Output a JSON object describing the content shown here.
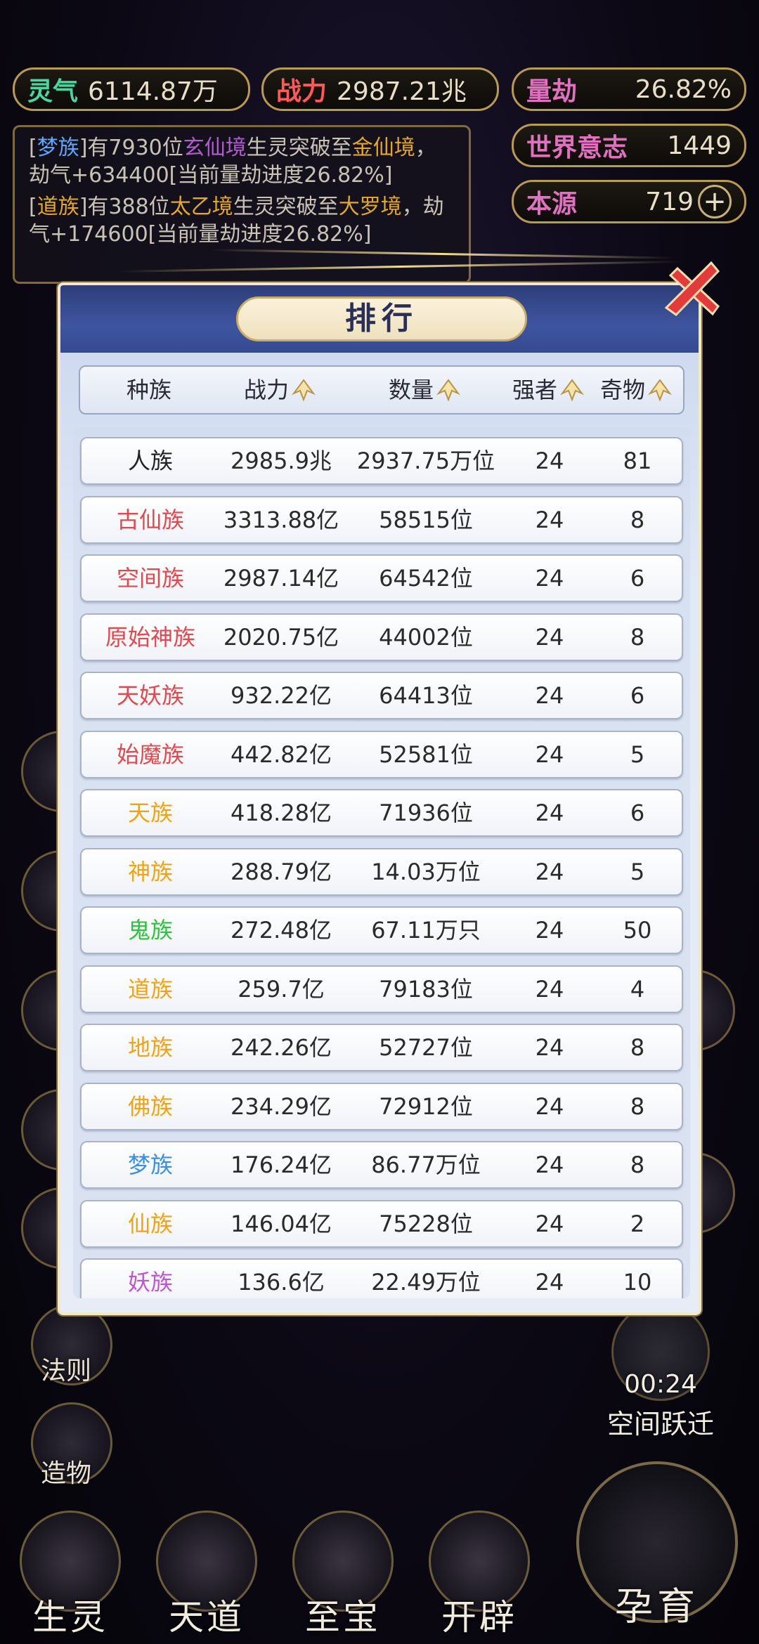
{
  "status": {
    "lingqi": {
      "label": "灵气",
      "value": "6114.87万"
    },
    "zhanli": {
      "label": "战力",
      "value": "2987.21兆"
    },
    "liangjie": {
      "label": "量劫",
      "value": "26.82%"
    },
    "shijie": {
      "label": "世界意志",
      "value": "1449"
    },
    "benyuan": {
      "label": "本源",
      "value": "719"
    }
  },
  "log": [
    {
      "a": "[",
      "race": "梦族",
      "b": "]有7930位",
      "from": "玄仙境",
      "c": "生灵突破至",
      "to": "金仙境",
      "d": "，劫气+634400[当前量劫进度26.82%]"
    },
    {
      "a": "[",
      "race": "道族",
      "b": "]有388位",
      "from": "太乙境",
      "c": "生灵突破至",
      "to": "大罗境",
      "d": "，劫气+174600[当前量劫进度26.82%]"
    }
  ],
  "panel": {
    "title": "排行",
    "headers": [
      "种族",
      "战力",
      "数量",
      "强者",
      "奇物"
    ]
  },
  "rows": [
    {
      "race": "人族",
      "power": "2985.9兆",
      "count": "2937.75万位",
      "strong": "24",
      "items": "81",
      "color": "#222222"
    },
    {
      "race": "古仙族",
      "power": "3313.88亿",
      "count": "58515位",
      "strong": "24",
      "items": "8",
      "color": "#e0494f"
    },
    {
      "race": "空间族",
      "power": "2987.14亿",
      "count": "64542位",
      "strong": "24",
      "items": "6",
      "color": "#e0494f"
    },
    {
      "race": "原始神族",
      "power": "2020.75亿",
      "count": "44002位",
      "strong": "24",
      "items": "8",
      "color": "#e0494f"
    },
    {
      "race": "天妖族",
      "power": "932.22亿",
      "count": "64413位",
      "strong": "24",
      "items": "6",
      "color": "#e0494f"
    },
    {
      "race": "始魔族",
      "power": "442.82亿",
      "count": "52581位",
      "strong": "24",
      "items": "5",
      "color": "#e0494f"
    },
    {
      "race": "天族",
      "power": "418.28亿",
      "count": "71936位",
      "strong": "24",
      "items": "6",
      "color": "#f0a316"
    },
    {
      "race": "神族",
      "power": "288.79亿",
      "count": "14.03万位",
      "strong": "24",
      "items": "5",
      "color": "#f0a316"
    },
    {
      "race": "鬼族",
      "power": "272.48亿",
      "count": "67.11万只",
      "strong": "24",
      "items": "50",
      "color": "#2fc23c"
    },
    {
      "race": "道族",
      "power": "259.7亿",
      "count": "79183位",
      "strong": "24",
      "items": "4",
      "color": "#f0a316"
    },
    {
      "race": "地族",
      "power": "242.26亿",
      "count": "52727位",
      "strong": "24",
      "items": "8",
      "color": "#f0a316"
    },
    {
      "race": "佛族",
      "power": "234.29亿",
      "count": "72912位",
      "strong": "24",
      "items": "8",
      "color": "#f0a316"
    },
    {
      "race": "梦族",
      "power": "176.24亿",
      "count": "86.77万位",
      "strong": "24",
      "items": "8",
      "color": "#3b8fe0"
    },
    {
      "race": "仙族",
      "power": "146.04亿",
      "count": "75228位",
      "strong": "24",
      "items": "2",
      "color": "#f0a316"
    },
    {
      "race": "妖族",
      "power": "136.6亿",
      "count": "22.49万位",
      "strong": "24",
      "items": "10",
      "color": "#c055d0"
    }
  ],
  "side": {
    "fa_ze": "法则",
    "zao_wu": "造物",
    "kongjian": "空间跃迁",
    "timer": "00:24"
  },
  "nav": {
    "shengling": "生灵",
    "tiandao": "天道",
    "zhibao": "至宝",
    "kaipi": "开辟",
    "yunyu": "孕育"
  }
}
